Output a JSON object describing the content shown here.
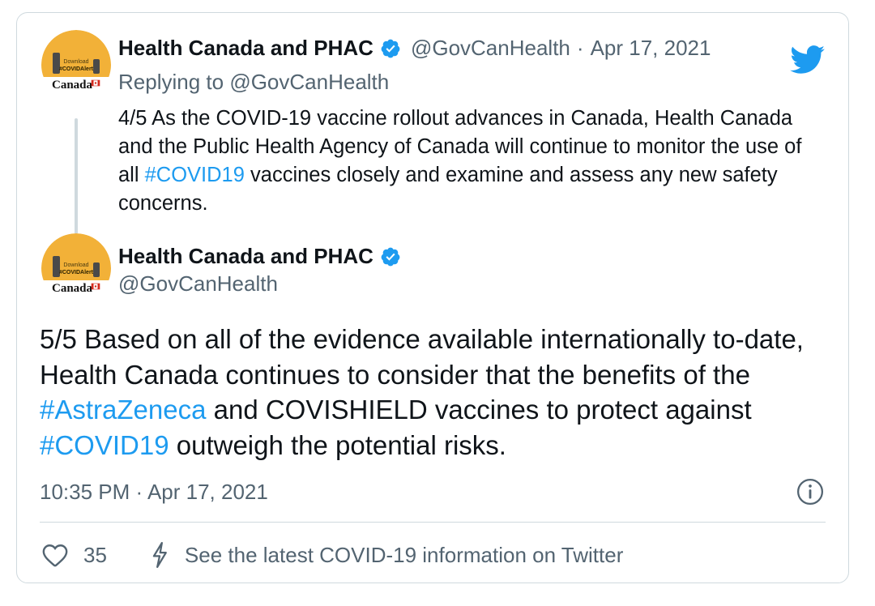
{
  "first_tweet": {
    "author_name": "Health Canada and PHAC",
    "author_handle": "@GovCanHealth",
    "separator": "·",
    "date": "Apr 17, 2021",
    "replying_label": "Replying to",
    "replying_handle": "@GovCanHealth",
    "text_parts": {
      "before": "4/5 As the COVID-19 vaccine rollout advances in Canada, Health Canada and the Public Health Agency of Canada will continue to monitor the use of all ",
      "hashtag": "#COVID19",
      "after": " vaccines closely and examine and assess any new safety concerns."
    }
  },
  "main_tweet": {
    "author_name": "Health Canada and PHAC",
    "author_handle": "@GovCanHealth",
    "text_parts": {
      "part1": "5/5 Based on all of the evidence available internationally to-date, Health Canada continues to consider that the benefits of the ",
      "hashtag1": "#AstraZeneca",
      "part2": " and COVISHIELD vaccines to protect against ",
      "hashtag2": "#COVID19",
      "part3": " outweigh the potential risks."
    },
    "timestamp": "10:35 PM · Apr 17, 2021",
    "like_count": "35",
    "info_link_text": "See the latest COVID-19 information on Twitter"
  },
  "avatar": {
    "text_download": "Download",
    "text_covidalert": "#COVIDAlert",
    "text_canada": "Canada"
  },
  "icons": {
    "verified": "verified-badge-icon",
    "twitter": "twitter-bird-icon",
    "info": "info-icon",
    "like": "heart-icon",
    "bolt": "lightning-icon"
  },
  "colors": {
    "link": "#1d9bf0",
    "muted": "#536471",
    "avatar_bg": "#f2b138",
    "verified": "#1d9bf0"
  }
}
